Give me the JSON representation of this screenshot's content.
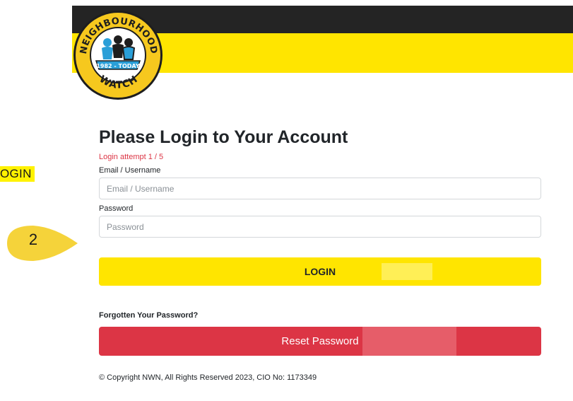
{
  "header": {
    "logo": {
      "top_text": "NEIGHBOURHOOD",
      "bottom_text": "WATCH",
      "ribbon_text": "1982 - TODAY"
    },
    "colors": {
      "black_band": "#242424",
      "yellow_band": "#ffe500"
    }
  },
  "annotations": {
    "side_label": "OGIN",
    "step_number": "2",
    "badge_color": "#f5d33a"
  },
  "form": {
    "title": "Please Login to Your Account",
    "attempt": "Login attempt 1 / 5",
    "email": {
      "label": "Email / Username",
      "placeholder": "Email / Username",
      "value": ""
    },
    "password": {
      "label": "Password",
      "placeholder": "Password",
      "value": ""
    },
    "login_button": "LOGIN",
    "forgot_label": "Forgotten Your Password?",
    "reset_button": "Reset Password",
    "colors": {
      "login": "#ffe500",
      "reset": "#dc3545",
      "attempt": "#dc3545"
    }
  },
  "footer": {
    "copyright": "© Copyright NWN, All Rights Reserved 2023, CIO No: 1173349"
  }
}
